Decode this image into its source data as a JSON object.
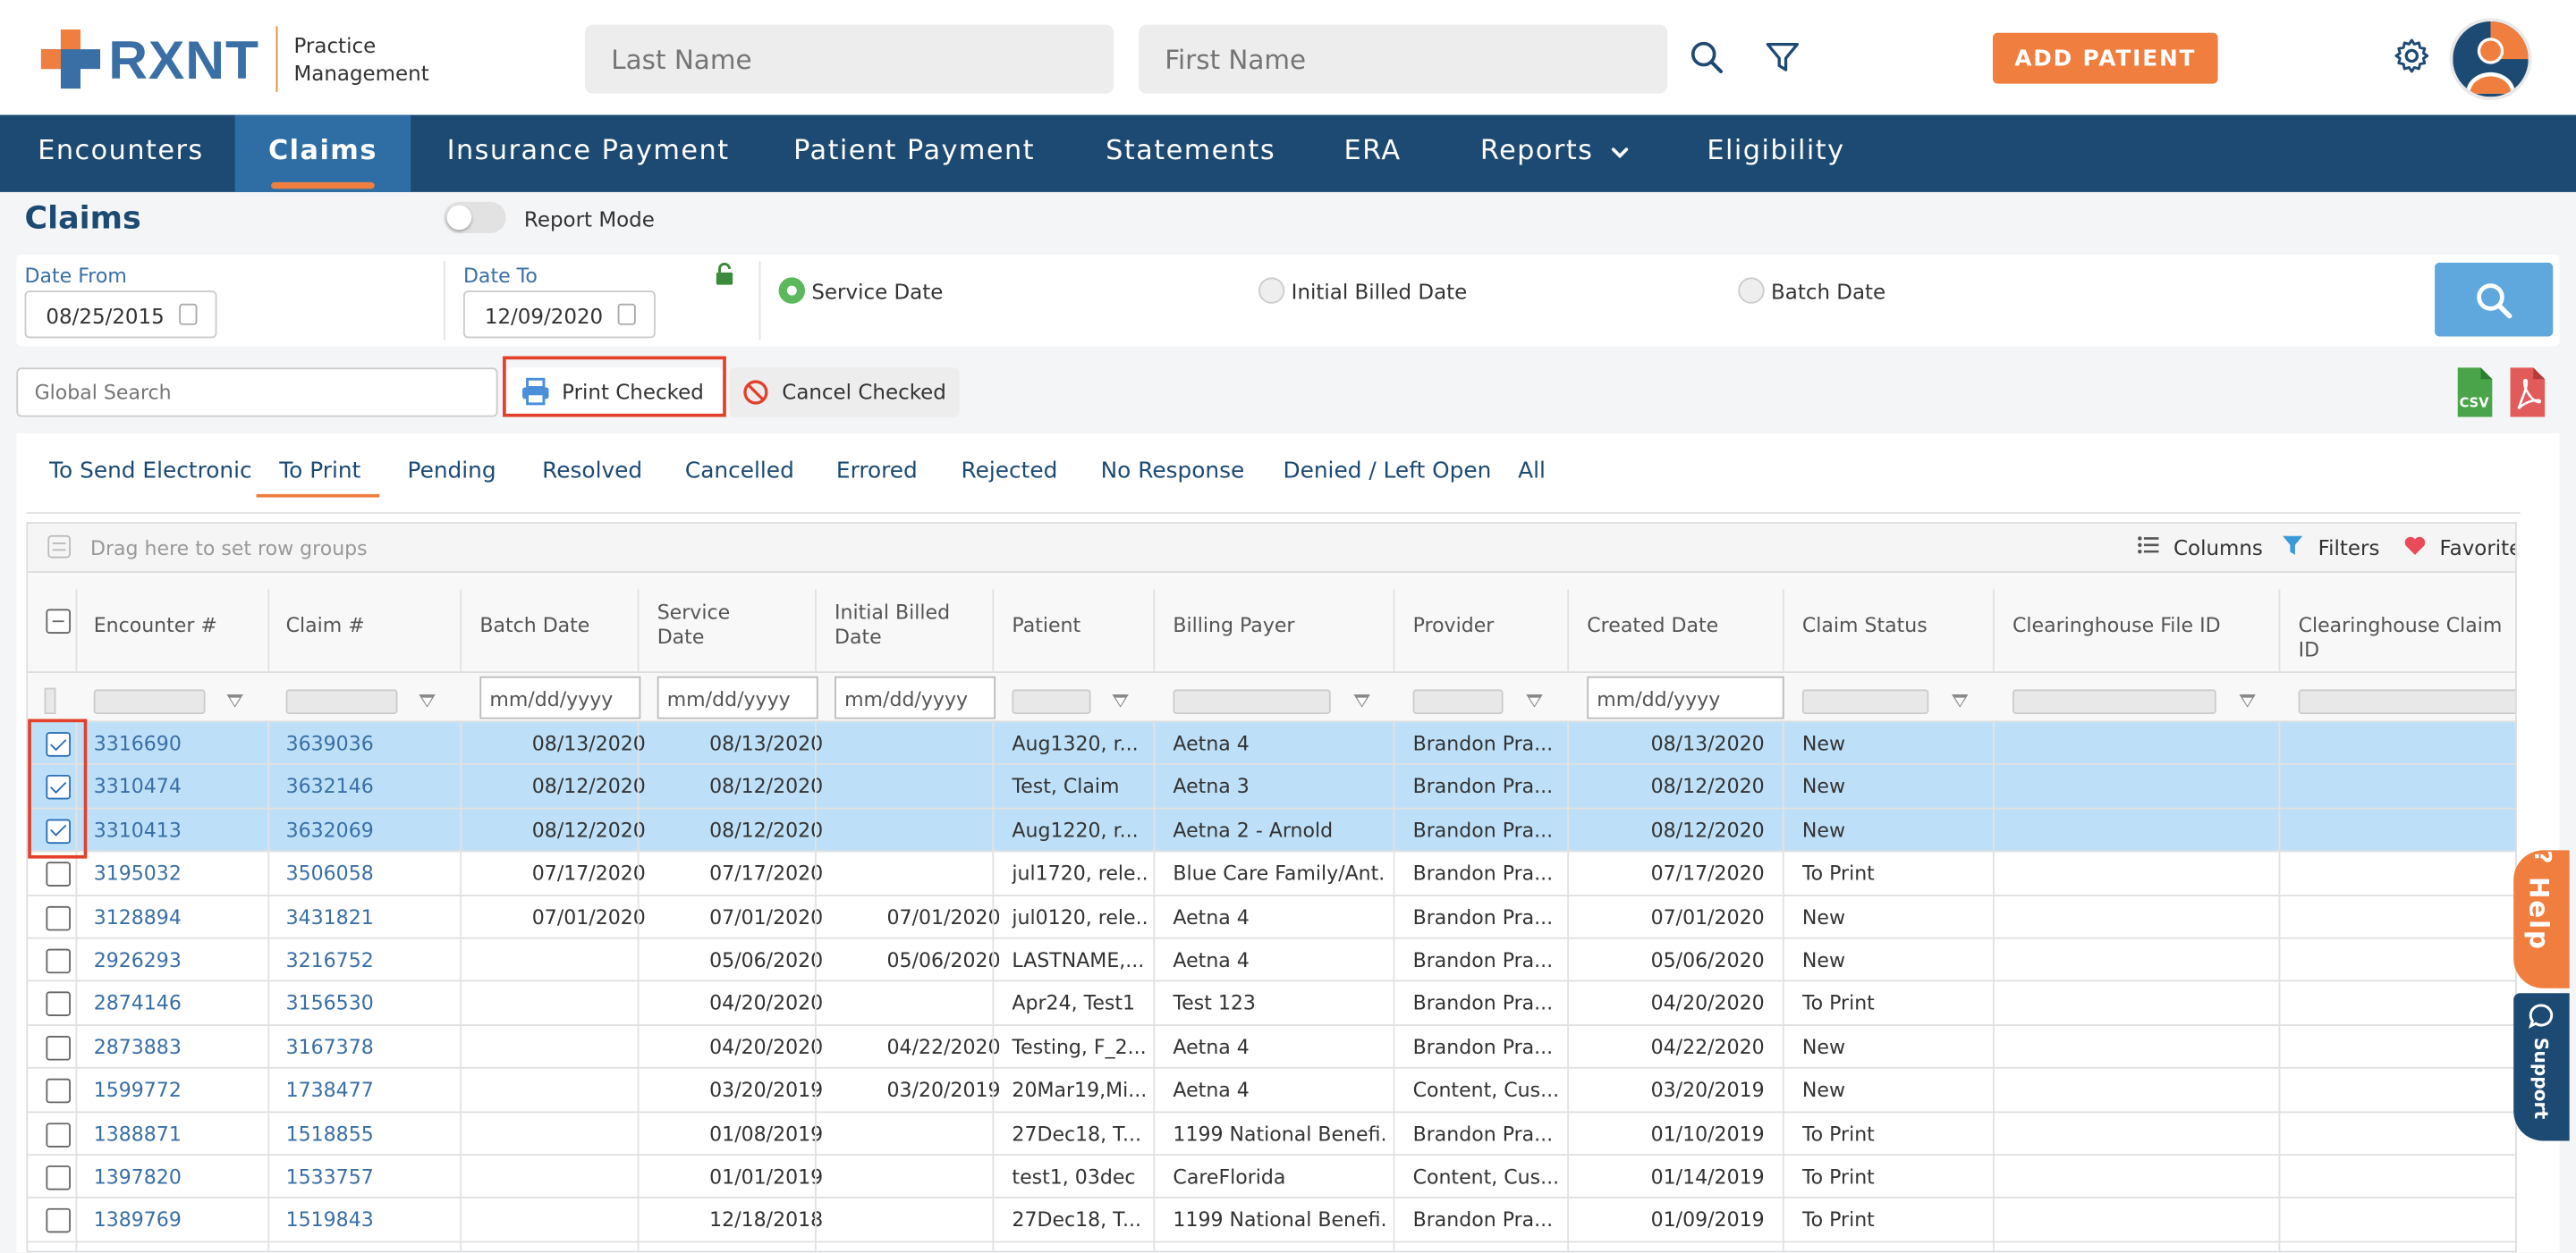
{
  "header": {
    "logo_text": "RXNT",
    "logo_sub_line1": "Practice",
    "logo_sub_line2": "Management",
    "last_name_placeholder": "Last Name",
    "first_name_placeholder": "First Name",
    "add_patient_label": "ADD PATIENT"
  },
  "nav": {
    "items": [
      {
        "label": "Encounters"
      },
      {
        "label": "Claims"
      },
      {
        "label": "Insurance Payment"
      },
      {
        "label": "Patient Payment"
      },
      {
        "label": "Statements"
      },
      {
        "label": "ERA"
      },
      {
        "label": "Reports"
      },
      {
        "label": "Eligibility"
      }
    ],
    "active": "Claims"
  },
  "page": {
    "title": "Claims",
    "report_mode_label": "Report Mode"
  },
  "filters": {
    "date_from_label": "Date From",
    "date_from_value": "08/25/2015",
    "date_to_label": "Date To",
    "date_to_value": "12/09/2020",
    "radio_service": "Service Date",
    "radio_initial": "Initial Billed Date",
    "radio_batch": "Batch Date",
    "selected_radio": "Service Date"
  },
  "actions": {
    "global_search_placeholder": "Global Search",
    "print_checked": "Print Checked",
    "cancel_checked": "Cancel Checked",
    "csv_label": "CSV"
  },
  "tabs": {
    "items": [
      "To Send Electronic",
      "To Print",
      "Pending",
      "Resolved",
      "Cancelled",
      "Errored",
      "Rejected",
      "No Response",
      "Denied / Left Open",
      "All"
    ],
    "active": "To Print"
  },
  "grid": {
    "group_hint": "Drag here to set row groups",
    "columns_label": "Columns",
    "filters_label": "Filters",
    "favorites_label": "Favorites",
    "date_placeholder": "mm/dd/yyyy",
    "headers": {
      "encounter": "Encounter #",
      "claim": "Claim #",
      "batch_date": "Batch Date",
      "service_date_1": "Service",
      "service_date_2": "Date",
      "initial_billed_1": "Initial Billed",
      "initial_billed_2": "Date",
      "patient": "Patient",
      "billing_payer": "Billing Payer",
      "provider": "Provider",
      "created_date": "Created Date",
      "claim_status": "Claim Status",
      "ch_file_id": "Clearinghouse File ID",
      "ch_claim_id": "Clearinghouse Claim ID"
    },
    "rows": [
      {
        "encounter": "3316690",
        "claim": "3639036",
        "batch": "08/13/2020",
        "service": "08/13/2020",
        "initial": "",
        "patient": "Aug1320, r...",
        "payer": "Aetna 4",
        "provider": "Brandon Pra...",
        "created": "08/13/2020",
        "status": "New",
        "checked": true
      },
      {
        "encounter": "3310474",
        "claim": "3632146",
        "batch": "08/12/2020",
        "service": "08/12/2020",
        "initial": "",
        "patient": "Test, Claim",
        "payer": "Aetna 3",
        "provider": "Brandon Pra...",
        "created": "08/12/2020",
        "status": "New",
        "checked": true
      },
      {
        "encounter": "3310413",
        "claim": "3632069",
        "batch": "08/12/2020",
        "service": "08/12/2020",
        "initial": "",
        "patient": "Aug1220, r...",
        "payer": "Aetna 2 - Arnold",
        "provider": "Brandon Pra...",
        "created": "08/12/2020",
        "status": "New",
        "checked": true
      },
      {
        "encounter": "3195032",
        "claim": "3506058",
        "batch": "07/17/2020",
        "service": "07/17/2020",
        "initial": "",
        "patient": "jul1720, rele...",
        "payer": "Blue Care Family/Ant...",
        "provider": "Brandon Pra...",
        "created": "07/17/2020",
        "status": "To Print",
        "checked": false
      },
      {
        "encounter": "3128894",
        "claim": "3431821",
        "batch": "07/01/2020",
        "service": "07/01/2020",
        "initial": "07/01/2020",
        "patient": "jul0120, rele...",
        "payer": "Aetna 4",
        "provider": "Brandon Pra...",
        "created": "07/01/2020",
        "status": "New",
        "checked": false
      },
      {
        "encounter": "2926293",
        "claim": "3216752",
        "batch": "",
        "service": "05/06/2020",
        "initial": "05/06/2020",
        "patient": "LASTNAME,...",
        "payer": "Aetna 4",
        "provider": "Brandon Pra...",
        "created": "05/06/2020",
        "status": "New",
        "checked": false
      },
      {
        "encounter": "2874146",
        "claim": "3156530",
        "batch": "",
        "service": "04/20/2020",
        "initial": "",
        "patient": "Apr24, Test1",
        "payer": "Test 123",
        "provider": "Brandon Pra...",
        "created": "04/20/2020",
        "status": "To Print",
        "checked": false
      },
      {
        "encounter": "2873883",
        "claim": "3167378",
        "batch": "",
        "service": "04/20/2020",
        "initial": "04/22/2020",
        "patient": "Testing, F_2...",
        "payer": "Aetna 4",
        "provider": "Brandon Pra...",
        "created": "04/22/2020",
        "status": "New",
        "checked": false
      },
      {
        "encounter": "1599772",
        "claim": "1738477",
        "batch": "",
        "service": "03/20/2019",
        "initial": "03/20/2019",
        "patient": "20Mar19,Mi...",
        "payer": "Aetna 4",
        "provider": "Content, Cus...",
        "created": "03/20/2019",
        "status": "New",
        "checked": false
      },
      {
        "encounter": "1388871",
        "claim": "1518855",
        "batch": "",
        "service": "01/08/2019",
        "initial": "",
        "patient": "27Dec18, T...",
        "payer": "1199 National Benefi...",
        "provider": "Brandon Pra...",
        "created": "01/10/2019",
        "status": "To Print",
        "checked": false
      },
      {
        "encounter": "1397820",
        "claim": "1533757",
        "batch": "",
        "service": "01/01/2019",
        "initial": "",
        "patient": "test1, 03dec",
        "payer": "CareFlorida",
        "provider": "Content, Cus...",
        "created": "01/14/2019",
        "status": "To Print",
        "checked": false
      },
      {
        "encounter": "1389769",
        "claim": "1519843",
        "batch": "",
        "service": "12/18/2018",
        "initial": "",
        "patient": "27Dec18, T...",
        "payer": "1199 National Benefi...",
        "provider": "Brandon Pra...",
        "created": "01/09/2019",
        "status": "To Print",
        "checked": false
      }
    ]
  },
  "side": {
    "help_label": "Help",
    "support_label": "Support"
  },
  "colors": {
    "navy": "#1d4a73",
    "nav_active": "#2f6ea5",
    "orange": "#f07e3e",
    "link_blue": "#3a6fa6",
    "selected_row": "#bde0f8",
    "highlight_red": "#e3402c"
  }
}
